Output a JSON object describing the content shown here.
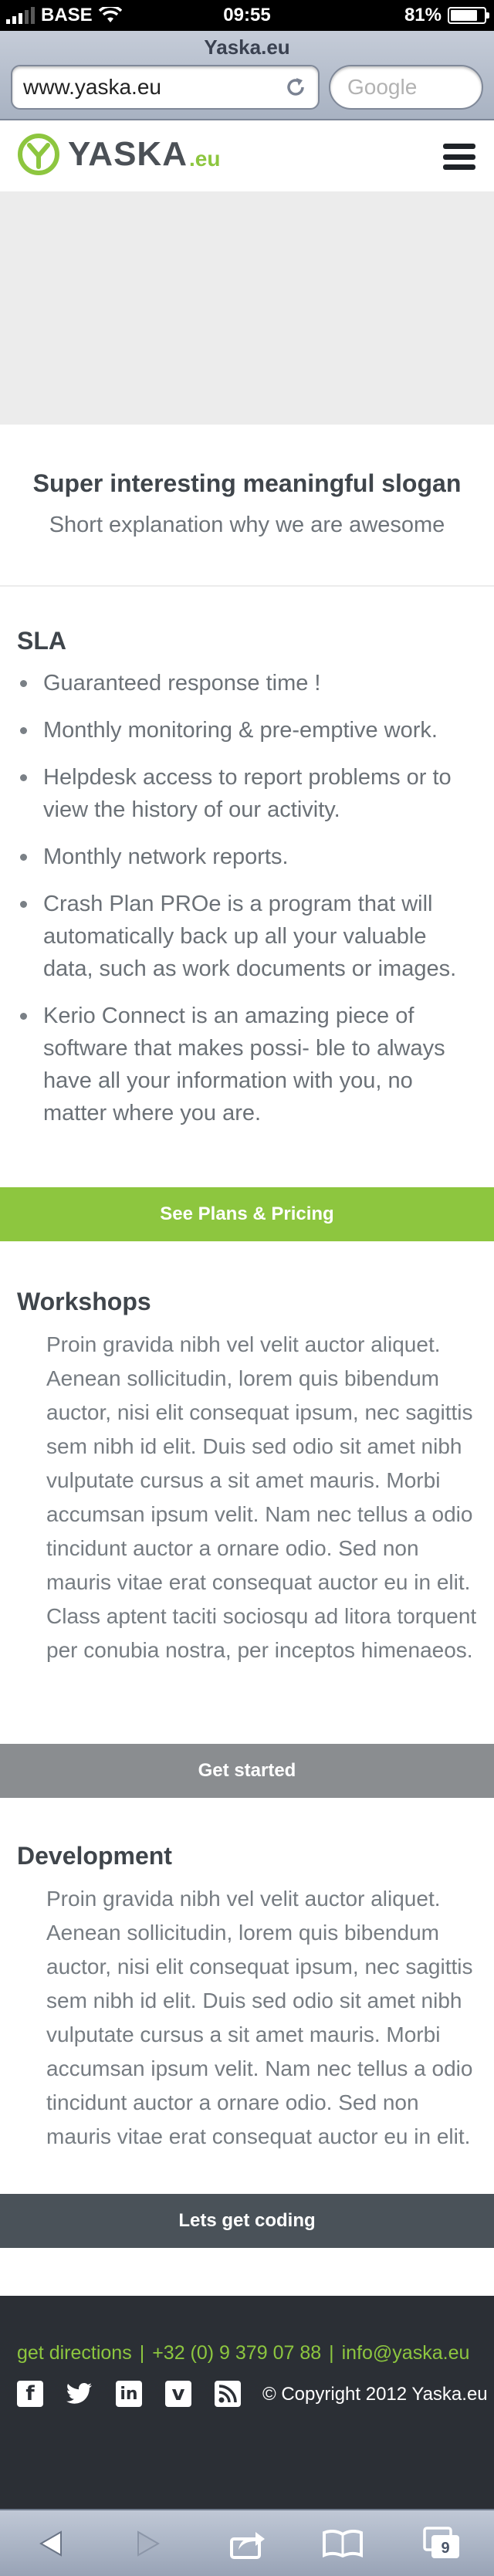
{
  "status_bar": {
    "carrier": "BASE",
    "time": "09:55",
    "battery": "81%",
    "battery_level": 0.81
  },
  "browser": {
    "page_title": "Yaska.eu",
    "url": "www.yaska.eu",
    "search_placeholder": "Google",
    "tabs_count": "9"
  },
  "header": {
    "logo_word": "YASKA",
    "logo_tld": ".eu"
  },
  "intro": {
    "slogan": "Super interesting meaningful slogan",
    "tagline": "Short explanation why we are awesome"
  },
  "sla": {
    "title": "SLA",
    "items": [
      "Guaranteed response time !",
      "Monthly monitoring & pre-emptive work.",
      "Helpdesk access to report problems or to view the history of our activity.",
      "Monthly network reports.",
      "Crash Plan PROe is a program that will automatically back up all your valuable data, such as work documents or images.",
      "Kerio Connect is an amazing piece of software that makes possi- ble to always have all your information with you, no matter where you are."
    ],
    "cta": "See Plans & Pricing"
  },
  "workshops": {
    "title": "Workshops",
    "body": "Proin gravida nibh vel velit auctor aliquet. Aenean sollicitudin, lorem quis bibendum auctor, nisi elit consequat ipsum, nec sagittis sem nibh id elit. Duis sed odio sit amet nibh vulputate cursus a sit amet mauris. Morbi accumsan ipsum velit. Nam nec tellus a odio tincidunt auctor a ornare odio. Sed non  mauris vitae erat consequat auctor eu in elit. Class aptent taciti sociosqu ad litora torquent per conubia nostra, per inceptos himenaeos.",
    "cta": "Get started"
  },
  "development": {
    "title": "Development",
    "body": "Proin gravida nibh vel velit auctor aliquet. Aenean sollicitudin, lorem quis bibendum auctor, nisi elit consequat ipsum, nec sagittis sem nibh id elit. Duis sed odio sit amet nibh vulputate cursus a sit amet mauris. Morbi accumsan ipsum velit. Nam nec tellus a odio tincidunt auctor a ornare odio. Sed non mauris vitae erat consequat auctor eu in elit.",
    "cta": "Lets get coding"
  },
  "footer": {
    "directions": "get directions",
    "phone": "+32 (0) 9 379 07 88",
    "email": "info@yaska.eu",
    "separator": "|",
    "copyright": "© Copyright 2012 Yaska.eu",
    "social": [
      "facebook-icon",
      "twitter-icon",
      "linkedin-icon",
      "vimeo-icon",
      "rss-icon"
    ]
  },
  "colors": {
    "brand_green": "#8dc63f",
    "gray_band": "#8a8d90",
    "dark_band": "#4a5259",
    "footer_bg": "#2b2f35"
  }
}
